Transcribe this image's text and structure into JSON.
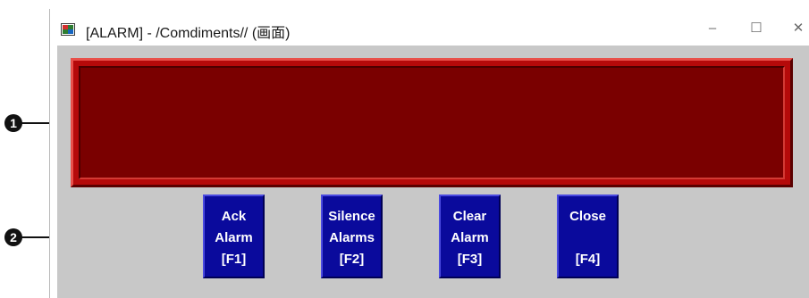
{
  "window": {
    "title": "[ALARM] - /Comdiments// (画面)",
    "controls": {
      "minimize": "–",
      "maximize": "☐",
      "close": "✕"
    }
  },
  "callouts": [
    "1",
    "2"
  ],
  "buttons": [
    {
      "line1": "Ack",
      "line2": "Alarm",
      "line3": "[F1]"
    },
    {
      "line1": "Silence",
      "line2": "Alarms",
      "line3": "[F2]"
    },
    {
      "line1": "Clear",
      "line2": "Alarm",
      "line3": "[F3]"
    },
    {
      "line1": "Close",
      "line2": "",
      "line3": "[F4]"
    }
  ],
  "colors": {
    "alarm_banner": "#7a0000",
    "button_face": "#0a0a9c",
    "client_background": "#c8c8c8"
  }
}
